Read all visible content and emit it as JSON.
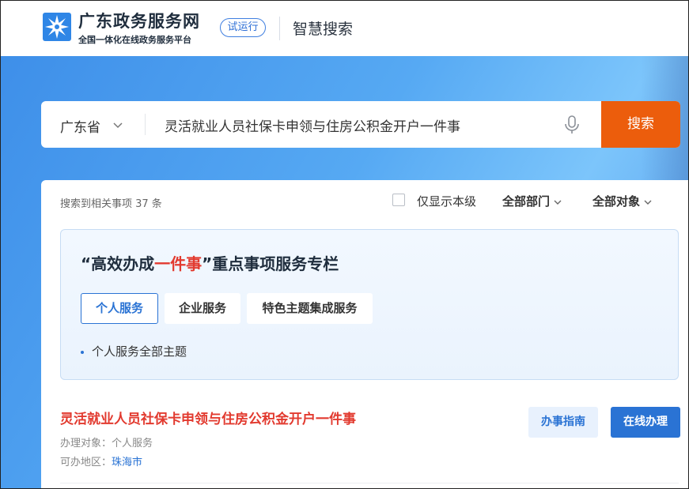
{
  "header": {
    "site_title": "广东政务服务网",
    "site_subtitle": "全国一体化在线政务服务平台",
    "trial_badge": "试运行",
    "section_title": "智慧搜索"
  },
  "search": {
    "province": "广东省",
    "query": "灵活就业人员社保卡申领与住房公积金开户一件事",
    "button_label": "搜索"
  },
  "results": {
    "count_text": "搜索到相关事项 37 条",
    "only_this_level_label": "仅显示本级",
    "only_this_level_checked": false,
    "filters": {
      "department": "全部部门",
      "target": "全部对象"
    }
  },
  "feature": {
    "title_prefix": "“高效办成",
    "title_highlight": "一件事",
    "title_suffix": "”重点事项服务专栏",
    "tabs": [
      {
        "label": "个人服务",
        "active": true
      },
      {
        "label": "企业服务",
        "active": false
      },
      {
        "label": "特色主题集成服务",
        "active": false
      }
    ],
    "topic_link": "个人服务全部主题"
  },
  "items": [
    {
      "title": "灵活就业人员社保卡申领与住房公积金开户一件事",
      "target_label": "办理对象：",
      "target_value": "个人服务",
      "region_label": "可办地区：",
      "region_value": "珠海市",
      "guide_label": "办事指南",
      "online_label": "在线办理"
    }
  ],
  "colors": {
    "accent_blue": "#2a73d4",
    "search_orange": "#ec5d0c",
    "highlight_red": "#e23a2f"
  }
}
